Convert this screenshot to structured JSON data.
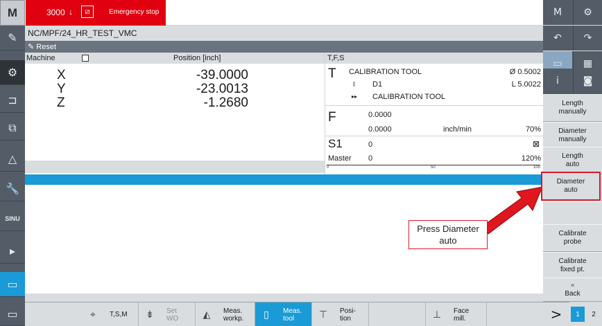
{
  "alarm": {
    "number": "3000",
    "text": "Emergency stop"
  },
  "program": {
    "path": "NC/MPF/24_HR_TEST_VMC",
    "reset": "Reset"
  },
  "machine": {
    "title": "Machine",
    "position_header": "Position [inch]",
    "axes": [
      {
        "name": "X",
        "value": "-39.0000"
      },
      {
        "name": "Y",
        "value": "-23.0013"
      },
      {
        "name": "Z",
        "value": "-1.2680"
      }
    ]
  },
  "tfs": {
    "header": "T,F,S",
    "t_label": "T",
    "tool_name": "CALIBRATION TOOL",
    "diameter": "Ø 0.5002",
    "d_number": "D1",
    "length": "L 5.0022",
    "next_tool": "CALIBRATION TOOL",
    "f_label": "F",
    "f_value1": "0.0000",
    "f_value2": "0.0000",
    "f_unit": "inch/min",
    "f_override": "70%",
    "s_label": "S1",
    "s_value": "0",
    "master_label": "Master",
    "master_value": "0",
    "s_override": "120%",
    "scale_min": "0",
    "scale_mid": "50",
    "scale_max": "100"
  },
  "callout": {
    "line1": "Press Diameter",
    "line2": "auto"
  },
  "right_softkeys": [
    {
      "line1": "Length",
      "line2": "manually"
    },
    {
      "line1": "Diameter",
      "line2": "manually"
    },
    {
      "line1": "Length",
      "line2": "auto"
    },
    {
      "line1": "Diameter",
      "line2": "auto"
    },
    {
      "line1": "",
      "line2": ""
    },
    {
      "line1": "Calibrate",
      "line2": "probe"
    },
    {
      "line1": "Calibrate",
      "line2": "fixed pt."
    },
    {
      "line1": "Back",
      "line2": ""
    }
  ],
  "bottom_softkeys": [
    {
      "line1": "T,S,M",
      "line2": ""
    },
    {
      "line1": "Set",
      "line2": "WO"
    },
    {
      "line1": "Meas.",
      "line2": "workp."
    },
    {
      "line1": "Meas.",
      "line2": "tool"
    },
    {
      "line1": "Posi-",
      "line2": "tion"
    },
    {
      "line1": "Face",
      "line2": "mill."
    }
  ],
  "pager": {
    "next": ">",
    "page1": "1",
    "page2": "2"
  },
  "colors": {
    "accent": "#1a9ad6",
    "alarm": "#e00010",
    "highlight": "#d8182a",
    "panel": "#d9dde0",
    "dark": "#545d67"
  },
  "icons": [
    "machine-icon",
    "edit-icon",
    "sun-icon",
    "program-icon",
    "copy-icon",
    "triangle-icon",
    "wrench-icon",
    "sinumerik-icon",
    "next-icon",
    "screen-icon",
    "undo-icon",
    "redo-icon",
    "info-icon",
    "camera-icon",
    "back-icon"
  ]
}
